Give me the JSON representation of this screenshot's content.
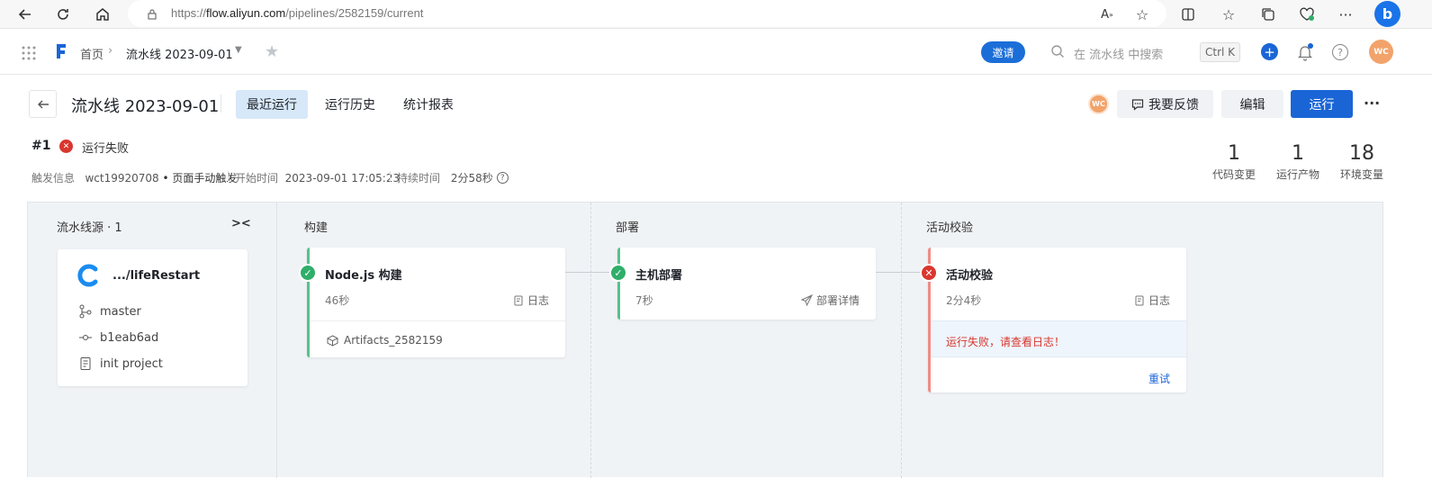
{
  "browser": {
    "url_prefix": "https://",
    "url_host": "flow.aliyun.com",
    "url_path": "/pipelines/2582159/current"
  },
  "header": {
    "breadcrumb_home": "首页",
    "pipeline_name": "流水线 2023-09-01",
    "invite_label": "邀请",
    "search_placeholder": "在 流水线 中搜索",
    "search_shortcut": "Ctrl K",
    "avatar_initials": "WC"
  },
  "pipeline": {
    "title": "流水线 2023-09-01",
    "tabs": [
      "最近运行",
      "运行历史",
      "统计报表"
    ],
    "feedback_label": "我要反馈",
    "edit_label": "编辑",
    "run_label": "运行",
    "more_label": "···"
  },
  "run": {
    "number": "#1",
    "status_text": "运行失败",
    "trigger_label": "触发信息",
    "trigger_user": "wct19920708",
    "trigger_mode": "• 页面手动触发",
    "start_label": "开始时间",
    "start_time": "2023-09-01 17:05:23",
    "duration_label": "持续时间",
    "duration": "2分58秒",
    "stats": [
      {
        "value": "1",
        "label": "代码变更"
      },
      {
        "value": "1",
        "label": "运行产物"
      },
      {
        "value": "18",
        "label": "环境变量"
      }
    ]
  },
  "source": {
    "title": "流水线源 · 1",
    "repo": ".../lifeRestart",
    "branch": "master",
    "commit": "b1eab6ad",
    "message": "init project"
  },
  "stages": [
    {
      "title": "构建",
      "job": {
        "name": "Node.js 构建",
        "duration": "46秒",
        "link": "日志",
        "status": "success",
        "artifact": "Artifacts_2582159"
      }
    },
    {
      "title": "部署",
      "job": {
        "name": "主机部署",
        "duration": "7秒",
        "link": "部署详情",
        "status": "success"
      }
    },
    {
      "title": "活动校验",
      "job": {
        "name": "活动校验",
        "duration": "2分4秒",
        "link": "日志",
        "status": "failed",
        "error": "运行失败，请查看日志！",
        "retry": "重试"
      }
    }
  ],
  "colors": {
    "primary": "#1a65d6",
    "success": "#2fae6a",
    "failure": "#d9362e",
    "canvas": "#f0f3f6"
  }
}
